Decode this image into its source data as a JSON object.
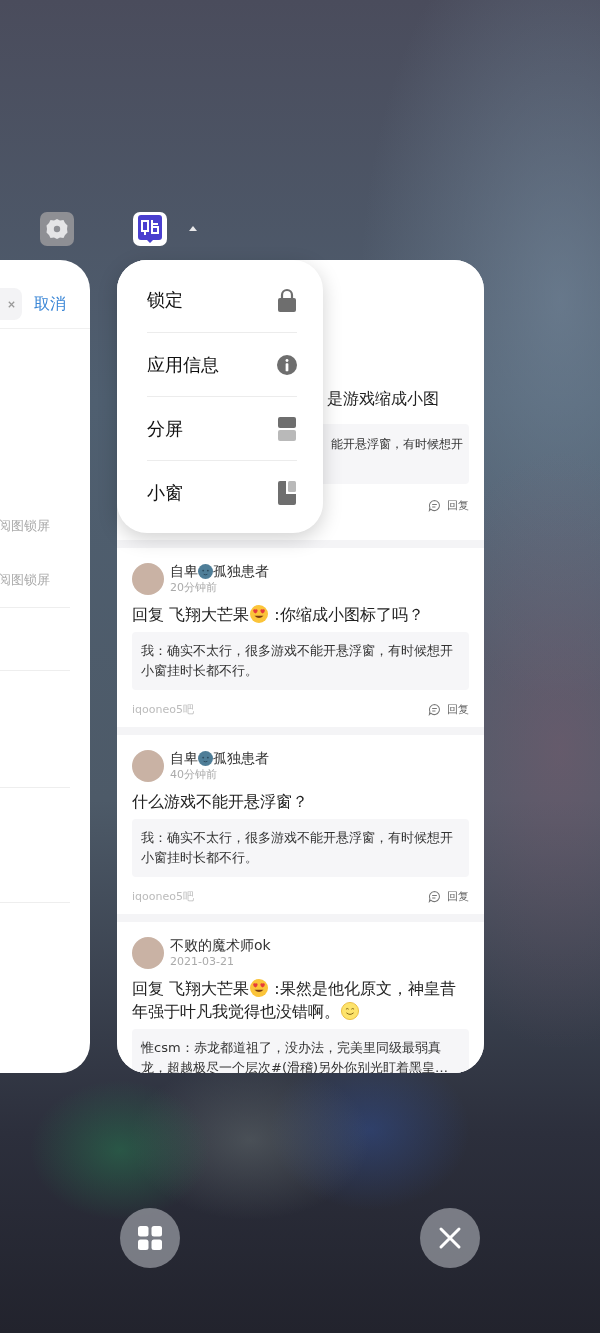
{
  "left_card": {
    "cancel": "取消",
    "rows": [
      {
        "text": "阅图锁屏"
      },
      {
        "text": "阅图锁屏"
      }
    ]
  },
  "app_menu": {
    "items": [
      {
        "kind": "lock",
        "label": "锁定"
      },
      {
        "kind": "info",
        "label": "应用信息"
      },
      {
        "kind": "split",
        "label": "分屏"
      },
      {
        "kind": "window",
        "label": "小窗"
      }
    ]
  },
  "partial_post": {
    "title": "是游戏缩成小图",
    "quote": "能开悬浮窗，有时候想开",
    "reply": "回复"
  },
  "posts": [
    {
      "name": [
        {
          "kind": "text",
          "text": "自卑"
        },
        {
          "kind": "moon"
        },
        {
          "kind": "text",
          "text": "孤独患者"
        }
      ],
      "time": "20分钟前",
      "title": [
        {
          "kind": "text",
          "text": "回复 飞翔大芒果"
        },
        {
          "kind": "heart-eyes"
        },
        {
          "kind": "text",
          "text": " :你缩成小图标了吗？"
        }
      ],
      "quote": "我：确实不太行，很多游戏不能开悬浮窗，有时候想开小窗挂时长都不行。",
      "forum": "iqooneo5吧",
      "reply": "回复"
    },
    {
      "name": [
        {
          "kind": "text",
          "text": "自卑"
        },
        {
          "kind": "moon"
        },
        {
          "kind": "text",
          "text": "孤独患者"
        }
      ],
      "time": "40分钟前",
      "title": [
        {
          "kind": "text",
          "text": "什么游戏不能开悬浮窗？"
        }
      ],
      "quote": "我：确实不太行，很多游戏不能开悬浮窗，有时候想开小窗挂时长都不行。",
      "forum": "iqooneo5吧",
      "reply": "回复"
    },
    {
      "name": [
        {
          "kind": "text",
          "text": "不败的魔术师ok"
        }
      ],
      "time": "2021-03-21",
      "title": [
        {
          "kind": "text",
          "text": "回复 飞翔大芒果"
        },
        {
          "kind": "heart-eyes"
        },
        {
          "kind": "text",
          "text": " :果然是他化原文，神皇昔"
        },
        {
          "kind": "text",
          "text": "年强于叶凡我觉得也没错啊。"
        },
        {
          "kind": "smile"
        }
      ],
      "quote": "惟csm：赤龙都道祖了，没办法，完美里同级最弱真龙，超越极尽一个层次#(滑稽)另外你别光盯着黑皇…"
    }
  ]
}
